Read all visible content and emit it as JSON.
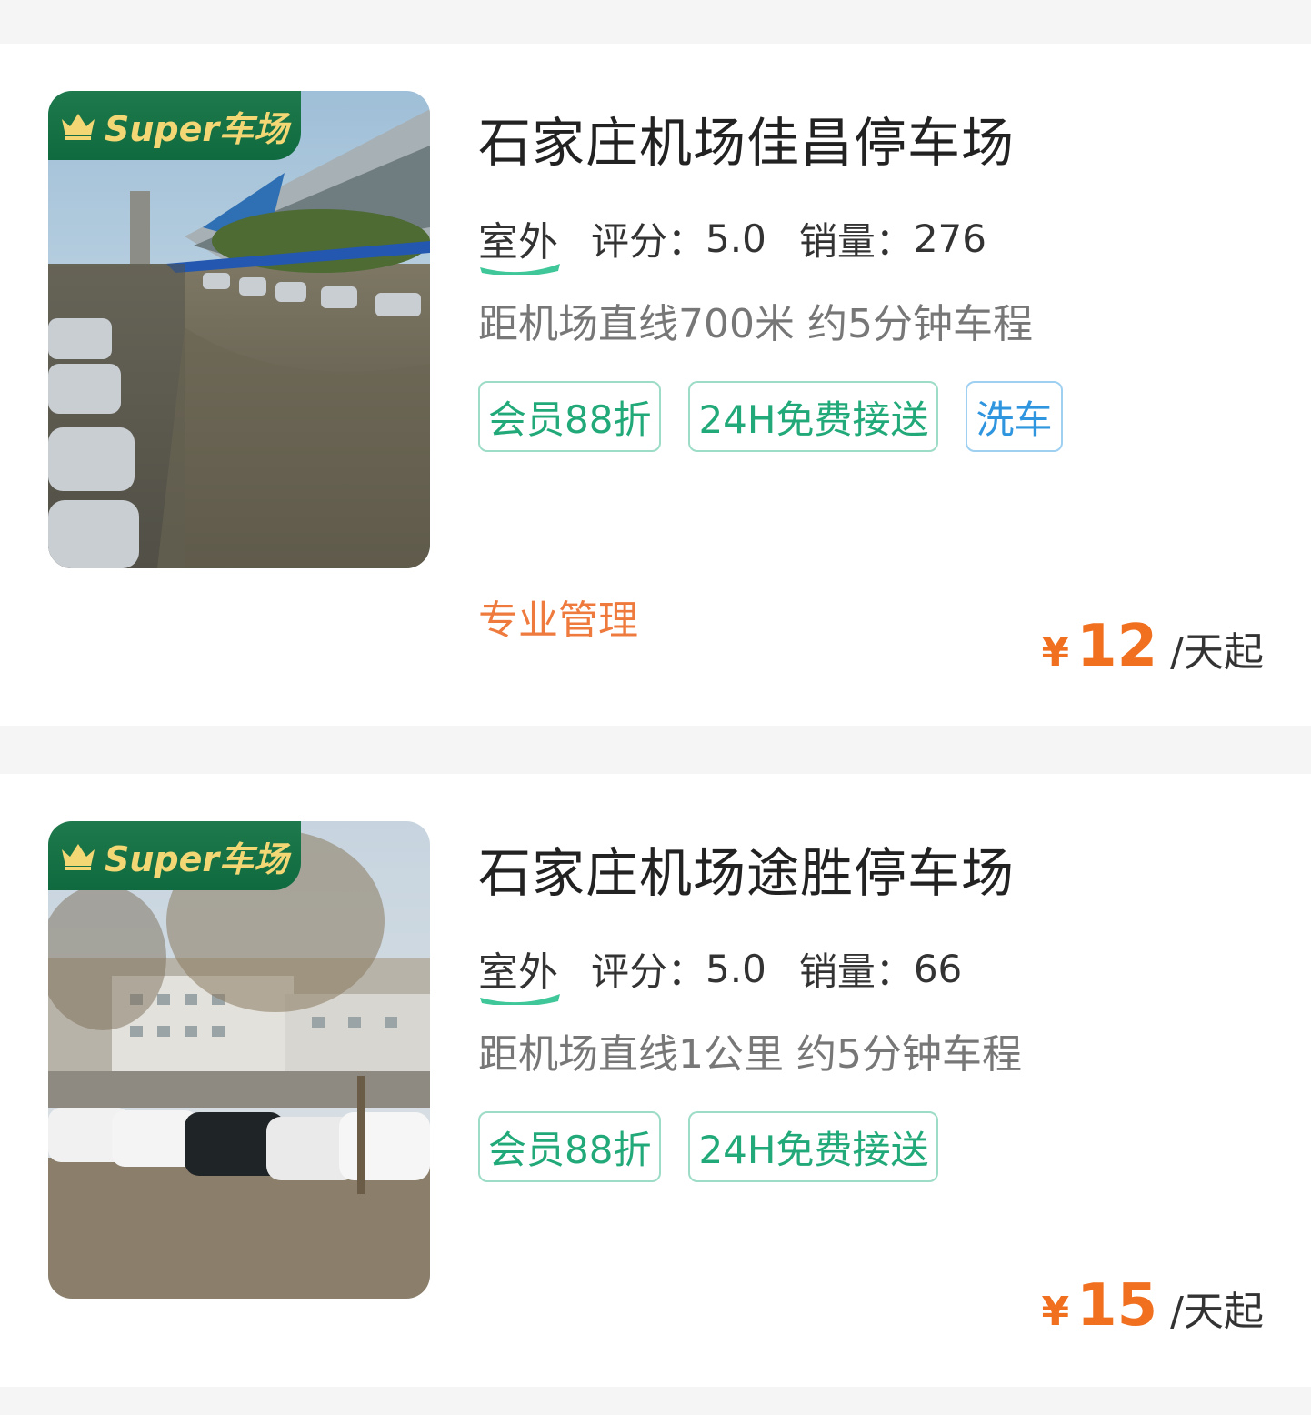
{
  "lots": [
    {
      "badge": "Super车场",
      "name": "石家庄机场佳昌停车场",
      "type": "室外",
      "rating_label": "评分：",
      "rating": "5.0",
      "sales_label": "销量：",
      "sales": "276",
      "distance": "距机场直线700米 约5分钟车程",
      "tags": [
        "会员88折",
        "24H免费接送"
      ],
      "service_tags": [
        "洗车"
      ],
      "highlight": "专业管理",
      "price_symbol": "¥",
      "price": "12",
      "price_unit": "/天起"
    },
    {
      "badge": "Super车场",
      "name": "石家庄机场途胜停车场",
      "type": "室外",
      "rating_label": "评分：",
      "rating": "5.0",
      "sales_label": "销量：",
      "sales": "66",
      "distance": "距机场直线1公里 约5分钟车程",
      "tags": [
        "会员88折",
        "24H免费接送"
      ],
      "price_symbol": "¥",
      "price": "15",
      "price_unit": "/天起"
    }
  ],
  "colors": {
    "accent_green": "#22a979",
    "accent_blue": "#2f95df",
    "price_orange": "#f07020",
    "highlight_orange": "#ef7a3e",
    "badge_green": "#0f6a3f",
    "badge_gold": "#f3d774"
  },
  "icons": {
    "badge_icon": "crown-icon",
    "type_underline": "wave-underline"
  }
}
